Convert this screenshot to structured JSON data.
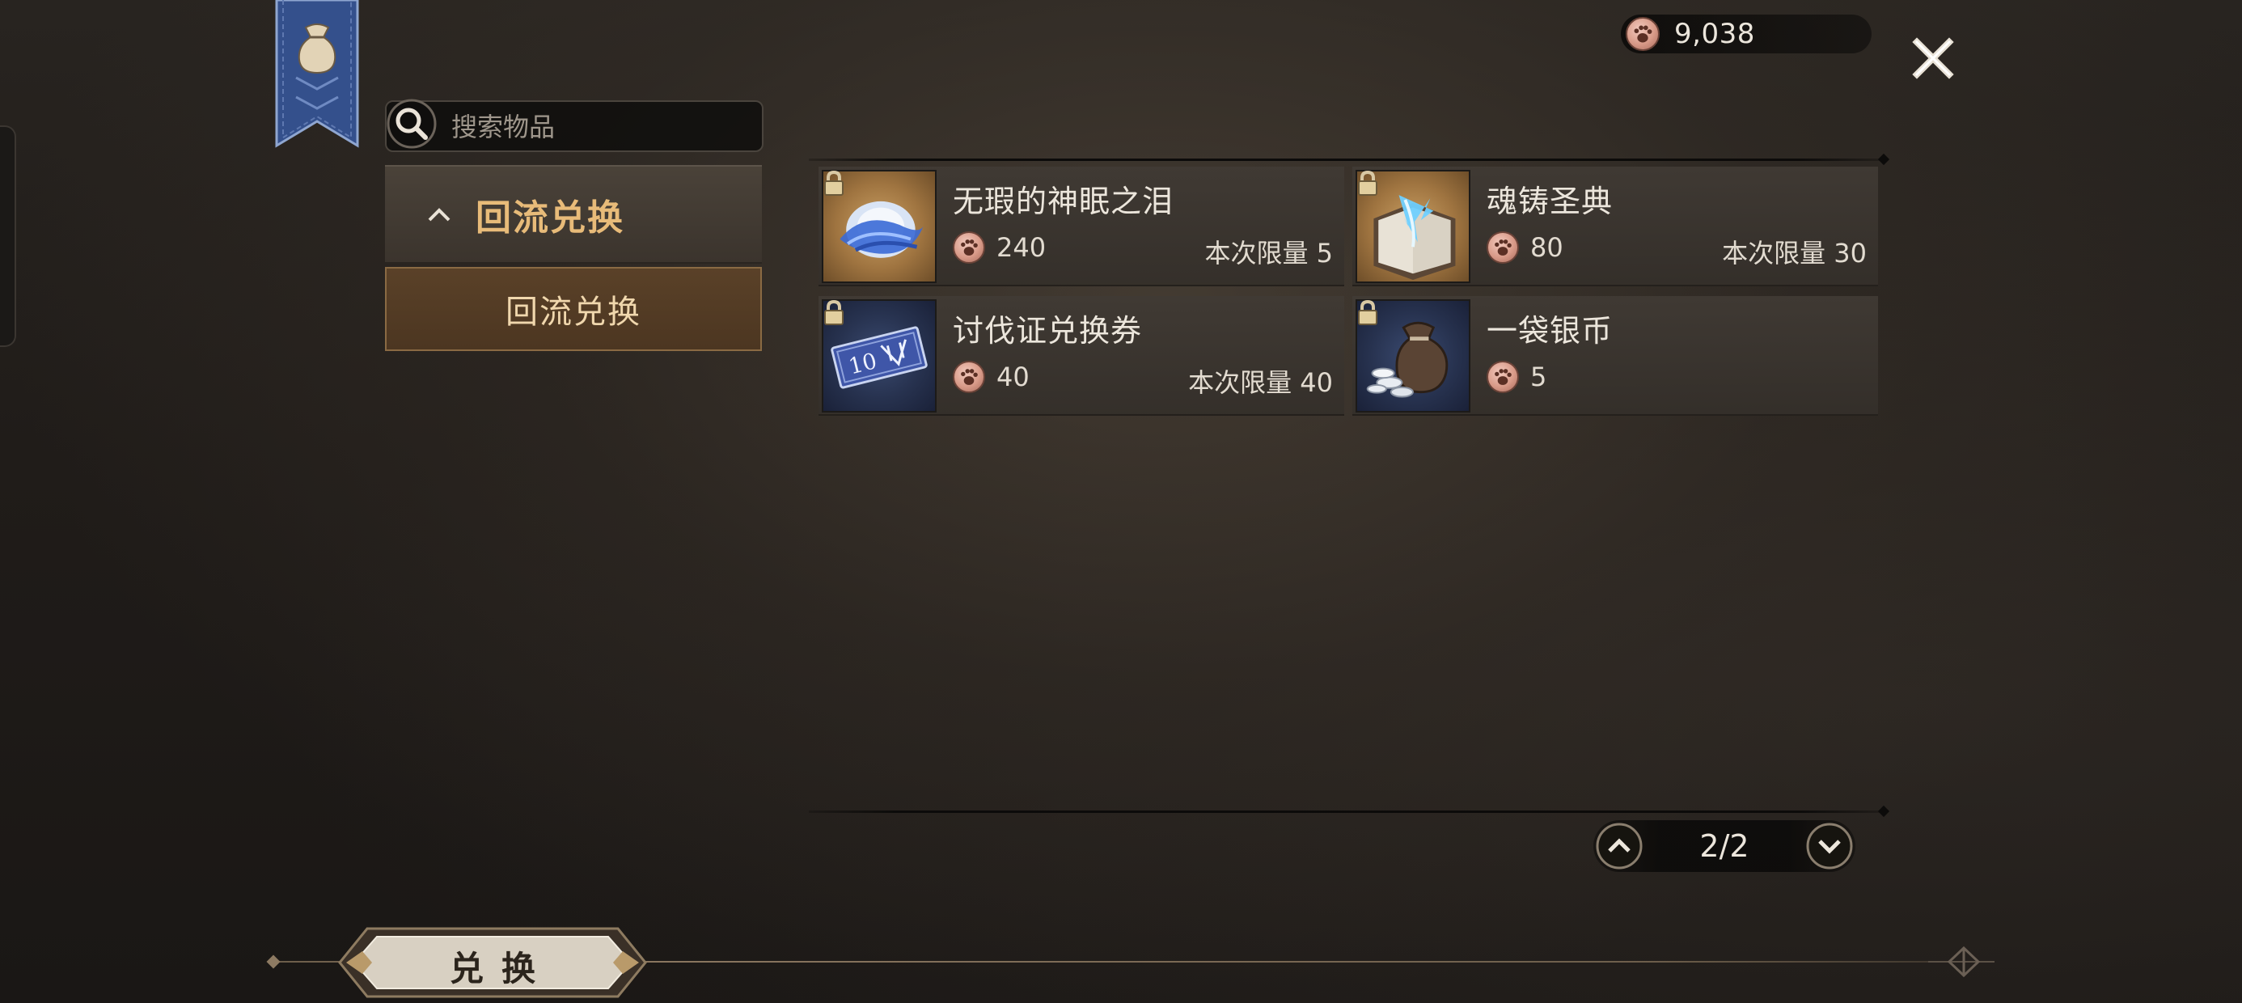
{
  "currency": {
    "value": "9,038",
    "icon": "paw-coin-icon"
  },
  "search": {
    "placeholder": "搜索物品"
  },
  "category": {
    "header": "回流兑换",
    "subitem": "回流兑换"
  },
  "items": [
    {
      "name": "无瑕的神眠之泪",
      "price": "240",
      "limit": "本次限量 5",
      "locked": true,
      "icon": "tear-orb-icon",
      "frame": "gold"
    },
    {
      "name": "魂铸圣典",
      "price": "80",
      "limit": "本次限量 30",
      "locked": true,
      "icon": "holy-book-icon",
      "frame": "gold"
    },
    {
      "name": "讨伐证兑换券",
      "price": "40",
      "limit": "本次限量 40",
      "locked": true,
      "icon": "voucher-ticket-icon",
      "frame": "blue"
    },
    {
      "name": "一袋银币",
      "price": "5",
      "limit": "",
      "locked": true,
      "icon": "silver-coin-bag-icon",
      "frame": "blue"
    }
  ],
  "pagination": {
    "label": "2/2"
  },
  "actions": {
    "exchange": "兑换"
  },
  "colors": {
    "accent": "#e8bb79",
    "selected_bg": "#5a4128",
    "card_bg": "#403a34"
  }
}
